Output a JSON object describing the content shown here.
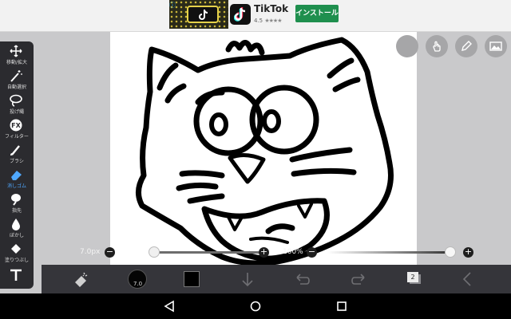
{
  "ad": {
    "app_name": "TikTok",
    "rating": "4.5",
    "stars": "★★★★",
    "install_label": "インストール",
    "info_icon": "info-icon"
  },
  "toolbar": {
    "tools": [
      {
        "name": "move",
        "label": "移動/拡大",
        "icon": "move-arrows-icon"
      },
      {
        "name": "auto-select",
        "label": "自動選択",
        "icon": "magic-wand-icon"
      },
      {
        "name": "lasso",
        "label": "投げ縄",
        "icon": "lasso-icon"
      },
      {
        "name": "filter",
        "label": "フィルター",
        "icon": "fx-icon"
      },
      {
        "name": "brush",
        "label": "ブラシ",
        "icon": "brush-icon"
      },
      {
        "name": "eraser",
        "label": "消しゴム",
        "icon": "eraser-icon",
        "active": true
      },
      {
        "name": "smudge",
        "label": "指先",
        "icon": "finger-smudge-icon"
      },
      {
        "name": "blur",
        "label": "ぼかし",
        "icon": "droplet-icon"
      },
      {
        "name": "fill",
        "label": "塗りつぶし",
        "icon": "fill-bucket-icon"
      },
      {
        "name": "text",
        "label": "",
        "icon": "text-icon"
      }
    ]
  },
  "sliders": {
    "brush_size_label": "7.0px",
    "brush_size_fraction": 0.22,
    "opacity_label": "100%",
    "opacity_fraction": 0.96,
    "minus": "−",
    "plus": "+"
  },
  "bottom_bar": {
    "brush_preview_value": "7.0",
    "current_color": "#000000",
    "layer_count": "2"
  },
  "colors": {
    "toolbar_bg": "#2b2b2f",
    "active_tool": "#4fa8ff",
    "bottom_bar_bg": "#35353a",
    "canvas_bg": "#ffffff",
    "install_green": "#1f8f4e"
  }
}
